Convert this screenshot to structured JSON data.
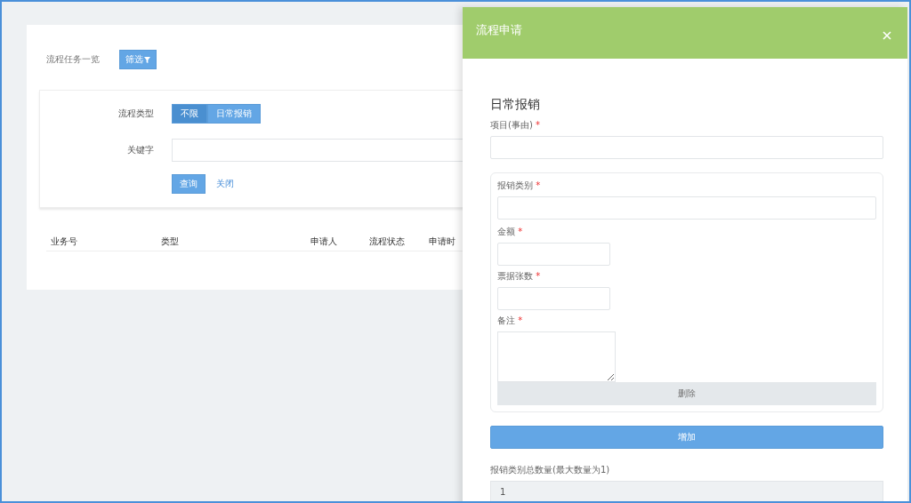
{
  "page": {
    "title": "流程任务一览",
    "filter_button": {
      "label": "筛选"
    }
  },
  "filter": {
    "type_label": "流程类型",
    "type_options": [
      {
        "label": "不限",
        "selected": true
      },
      {
        "label": "日常报销",
        "selected": false
      }
    ],
    "keyword_label": "关键字",
    "search_button": "查询",
    "close_link": "关闭"
  },
  "table": {
    "columns": [
      "业务号",
      "类型",
      "申请人",
      "流程状态",
      "申请时"
    ]
  },
  "drawer": {
    "title": "流程申请",
    "form_title": "日常报销",
    "project": {
      "label": "项目(事由)",
      "required_mark": "*"
    },
    "items": [
      {
        "fields": [
          {
            "kind": "wide",
            "label": "报销类别",
            "required_mark": "*"
          },
          {
            "kind": "short",
            "label": "金额",
            "required_mark": "*"
          },
          {
            "kind": "short",
            "label": "票据张数",
            "required_mark": "*"
          },
          {
            "kind": "textarea",
            "label": "备注",
            "required_mark": "*"
          }
        ],
        "delete_button": "删除"
      }
    ],
    "add_button": "增加",
    "total": {
      "label": "报销类别总数量(最大数量为1)",
      "value": "1"
    }
  }
}
